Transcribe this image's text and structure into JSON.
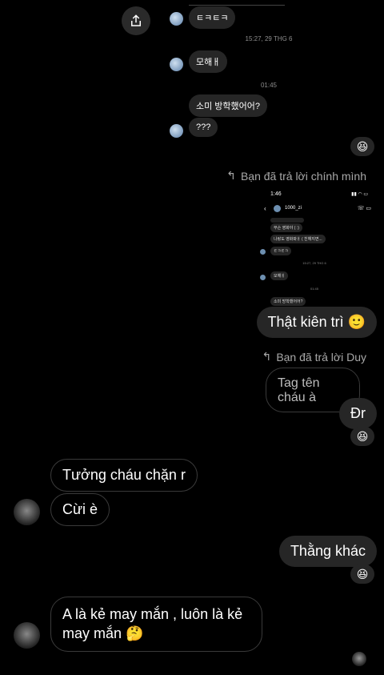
{
  "share_button": {
    "icon": "share-icon"
  },
  "top_messages": {
    "m1": "ㅌㅋㅌㅋ",
    "time1": "15:27, 29 THG 6",
    "m2": "모해ㅐ",
    "time2": "01:45",
    "m3": "소미 방학했어어?",
    "m4": "???",
    "reaction1": "😆"
  },
  "reply_self": {
    "label": "Bạn đã trả lời chính mình",
    "image": {
      "status_time": "1:46",
      "contact": "1000_zi",
      "lines": [
        "무슨 영화야 ( :)",
        "나랑도 영화봐ㅐ ( 친해지면...",
        "ㅌㅋㅌㅋ",
        "15:27, 29 THG 6",
        "모해ㅐ",
        "01:45",
        "소미 방학했어어?"
      ]
    },
    "message": "Thật kiên trì 🙂"
  },
  "reply_duy": {
    "label": "Bạn đã trả lời Duy",
    "quoted": "Tag tên cháu à",
    "message": "Đr",
    "reaction": "😆"
  },
  "incoming1": {
    "m1": "Tưởng cháu chặn r",
    "m2": "Cừi è"
  },
  "outgoing2": {
    "message": "Thằng khác",
    "reaction": "😆"
  },
  "incoming2": {
    "message": "A là kẻ may mắn , luôn là kẻ may mắn 🤔"
  },
  "colors": {
    "bubble": "#262626",
    "background": "#000000",
    "muted": "#8e8e8e"
  }
}
